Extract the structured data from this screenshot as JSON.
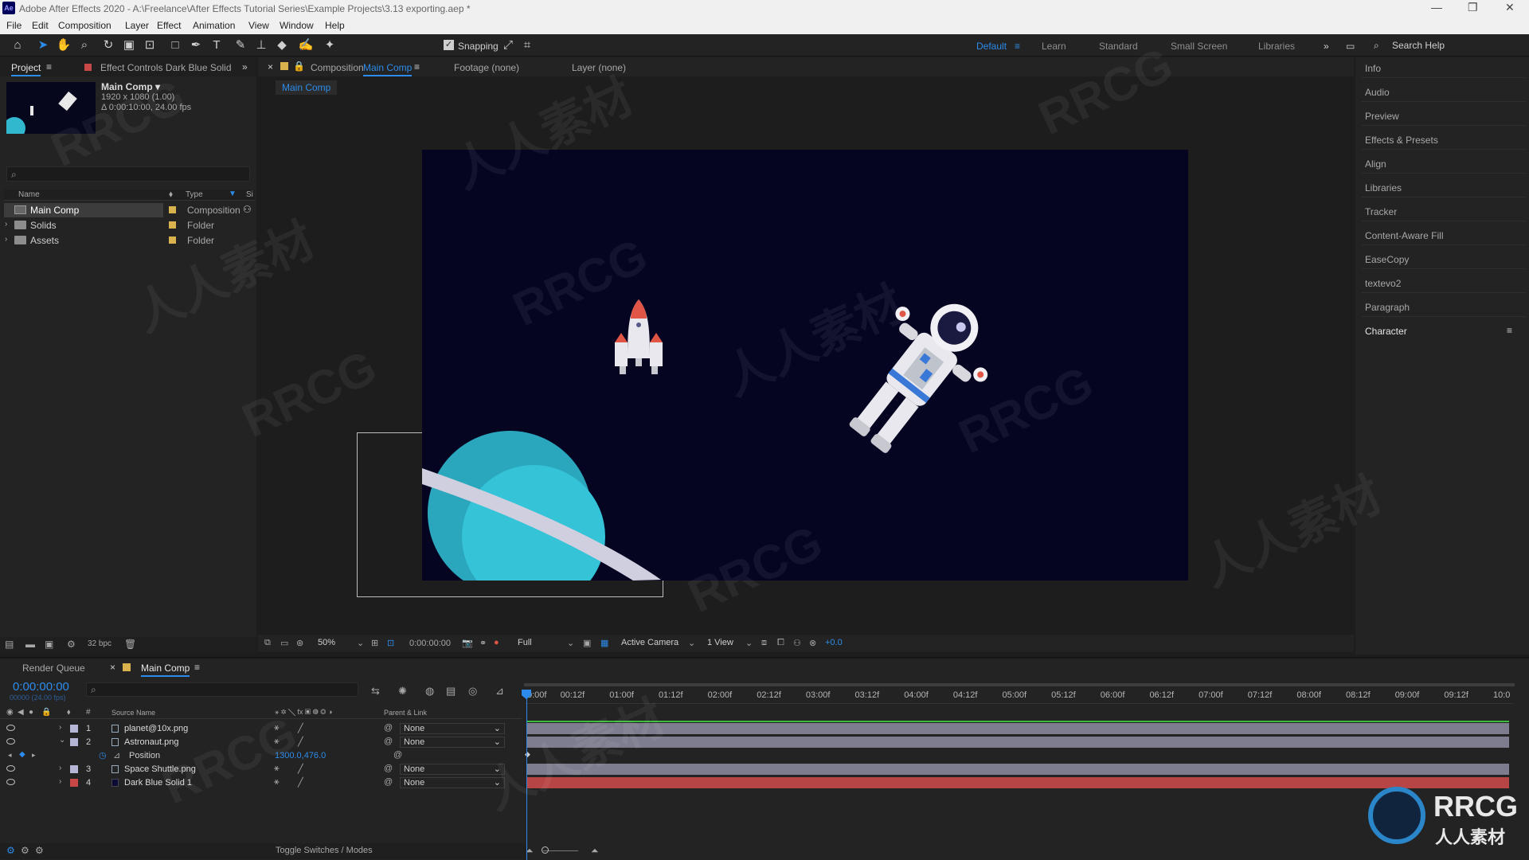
{
  "window": {
    "title": "Adobe After Effects 2020 - A:\\Freelance\\After Effects Tutorial Series\\Example Projects\\3.13 exporting.aep *",
    "app_icon": "Ae"
  },
  "menu": [
    "File",
    "Edit",
    "Composition",
    "Layer",
    "Effect",
    "Animation",
    "View",
    "Window",
    "Help"
  ],
  "toolbar": {
    "snapping_label": "Snapping",
    "workspaces": [
      "Default",
      "Learn",
      "Standard",
      "Small Screen",
      "Libraries"
    ],
    "active_workspace": "Default",
    "search_help_placeholder": "Search Help"
  },
  "project_panel": {
    "tab_project": "Project",
    "tab_effect_controls": "Effect Controls Dark Blue Solid",
    "comp_name": "Main Comp ▾",
    "comp_size": "1920 x 1080 (1.00)",
    "comp_duration": "Δ 0:00:10:00, 24.00 fps",
    "col_name": "Name",
    "col_type": "Type",
    "col_size": "Si",
    "items": [
      {
        "name": "Main Comp",
        "type": "Composition"
      },
      {
        "name": "Solids",
        "type": "Folder"
      },
      {
        "name": "Assets",
        "type": "Folder"
      }
    ],
    "bpc": "32 bpc"
  },
  "comp_viewer": {
    "tab_comp_prefix": "Composition",
    "tab_comp_name": "Main Comp",
    "tab_footage": "Footage (none)",
    "tab_layer": "Layer (none)",
    "breadcrumb": "Main Comp",
    "zoom": "50%",
    "timecode": "0:00:00:00",
    "resolution": "Full",
    "camera": "Active Camera",
    "views": "1 View",
    "exposure": "+0.0"
  },
  "right_panel": [
    "Info",
    "Audio",
    "Preview",
    "Effects & Presets",
    "Align",
    "Libraries",
    "Tracker",
    "Content-Aware Fill",
    "EaseCopy",
    "textevo2",
    "Paragraph",
    "Character"
  ],
  "timeline": {
    "tab_render_queue": "Render Queue",
    "tab_comp": "Main Comp",
    "current_time": "0:00:00:00",
    "fps_note": "00000 (24.00 fps)",
    "col_source_name": "Source Name",
    "col_parent": "Parent & Link",
    "layers": [
      {
        "num": "1",
        "name": "planet@10x.png",
        "parent": "None",
        "color": "#b5b5d6"
      },
      {
        "num": "2",
        "name": "Astronaut.png",
        "parent": "None",
        "color": "#b5b5d6"
      },
      {
        "num": "3",
        "name": "Space Shuttle.png",
        "parent": "None",
        "color": "#b5b5d6"
      },
      {
        "num": "4",
        "name": "Dark Blue Solid 1",
        "parent": "None",
        "color": "#c84747"
      }
    ],
    "property_name": "Position",
    "property_value": "1300.0,476.0",
    "ruler": [
      "0:00f",
      "00:12f",
      "01:00f",
      "01:12f",
      "02:00f",
      "02:12f",
      "03:00f",
      "03:12f",
      "04:00f",
      "04:12f",
      "05:00f",
      "05:12f",
      "06:00f",
      "06:12f",
      "07:00f",
      "07:12f",
      "08:00f",
      "08:12f",
      "09:00f",
      "09:12f",
      "10:0"
    ],
    "toggle_label": "Toggle Switches / Modes"
  },
  "watermark": {
    "brand": "RRCG",
    "sub": "人人素材"
  }
}
